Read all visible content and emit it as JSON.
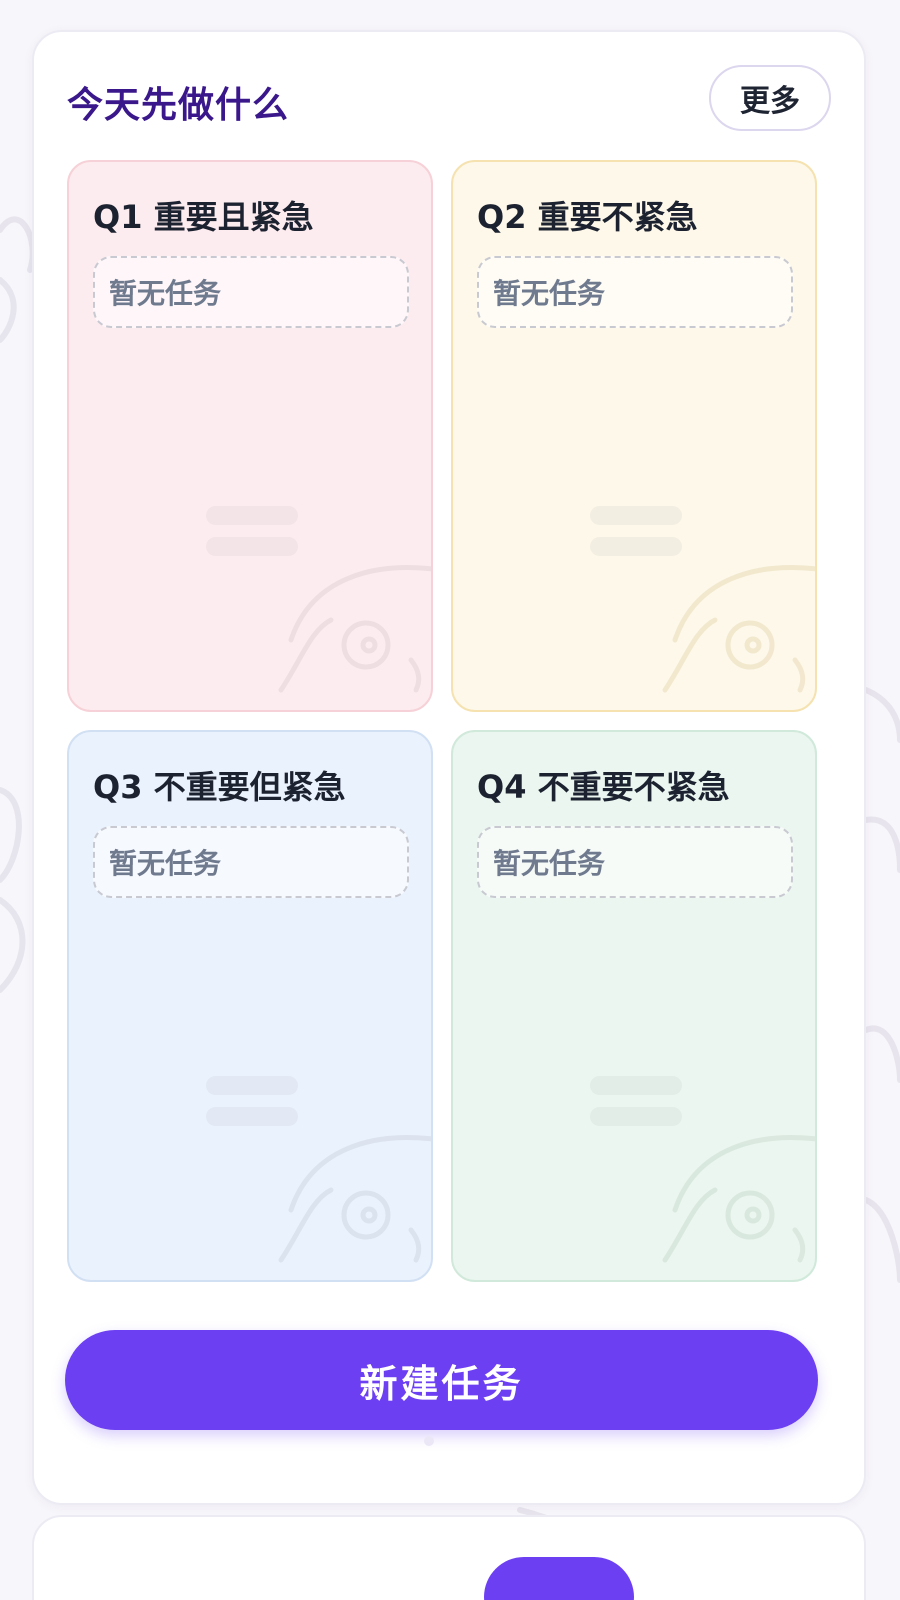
{
  "card": {
    "title": "今天先做什么",
    "more_label": "更多"
  },
  "quadrants": [
    {
      "title": "Q1 重要且紧急",
      "empty_text": "暂无任务",
      "color": "#fdecef"
    },
    {
      "title": "Q2 重要不紧急",
      "empty_text": "暂无任务",
      "color": "#fdf8e9"
    },
    {
      "title": "Q3 不重要但紧急",
      "empty_text": "暂无任务",
      "color": "#eaf2fd"
    },
    {
      "title": "Q4 不重要不紧急",
      "empty_text": "暂无任务",
      "color": "#eaf6ef"
    }
  ],
  "actions": {
    "new_task_label": "新建任务"
  },
  "colors": {
    "accent": "#6d3ff2",
    "title": "#3a178a"
  }
}
